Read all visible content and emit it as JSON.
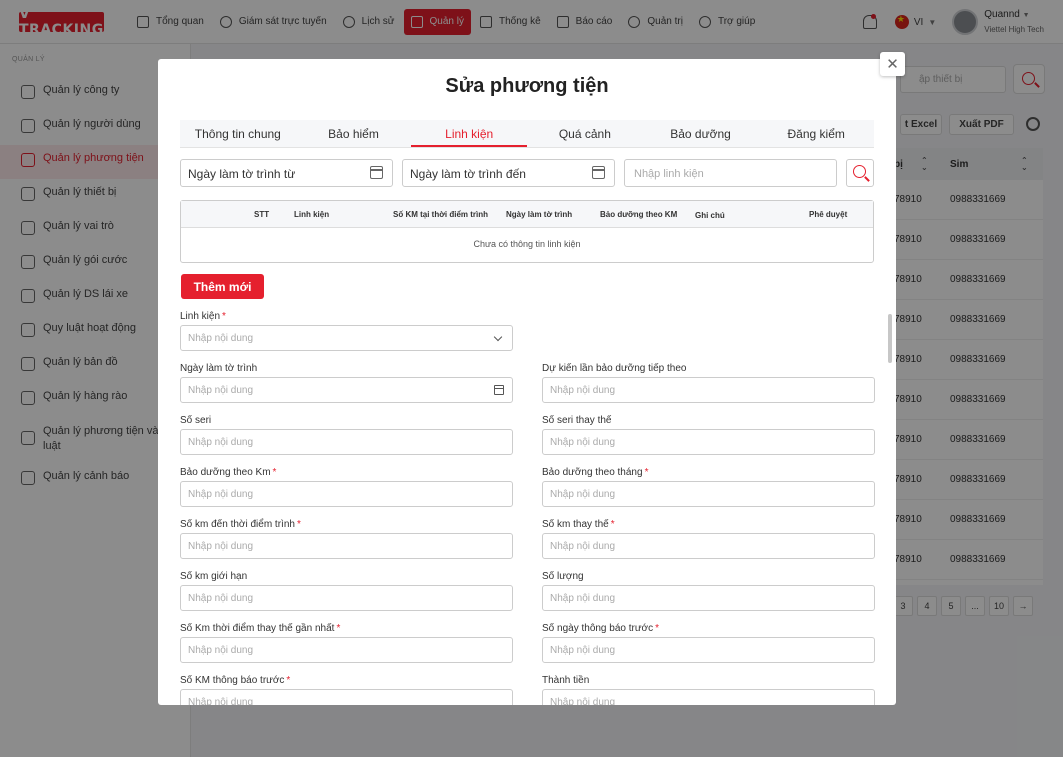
{
  "header": {
    "logo": "V TRACKING",
    "nav": [
      {
        "label": "Tổng quan",
        "icon": "dashboard-icon"
      },
      {
        "label": "Giám sát trực tuyến",
        "icon": "target-icon"
      },
      {
        "label": "Lịch sử",
        "icon": "history-icon"
      },
      {
        "label": "Quản lý",
        "icon": "grid-icon"
      },
      {
        "label": "Thống kê",
        "icon": "document-icon"
      },
      {
        "label": "Báo cáo",
        "icon": "clipboard-icon"
      },
      {
        "label": "Quản trị",
        "icon": "gear-icon"
      },
      {
        "label": "Trợ giúp",
        "icon": "help-icon"
      }
    ],
    "active_nav": "Quản lý",
    "language": "VI",
    "user_name": "Quannd",
    "user_org": "Viettel High Tech"
  },
  "sidebar": {
    "title": "QUẢN LÝ",
    "items": [
      {
        "label": "Quản lý công ty"
      },
      {
        "label": "Quản lý người dùng"
      },
      {
        "label": "Quản lý phương tiện"
      },
      {
        "label": "Quản lý thiết bị"
      },
      {
        "label": "Quản lý vai trò"
      },
      {
        "label": "Quản lý gói cước"
      },
      {
        "label": "Quản lý DS lái xe"
      },
      {
        "label": "Quy luật hoạt động"
      },
      {
        "label": "Quản lý bản đồ"
      },
      {
        "label": "Quản lý hàng rào"
      },
      {
        "label": "Quản lý phương tiện và quy luật"
      },
      {
        "label": "Quản lý cảnh báo"
      }
    ],
    "active_item": "Quản lý phương tiện"
  },
  "background": {
    "search_placeholder": "ập thiết bị",
    "export_excel": "t Excel",
    "export_pdf": "Xuất PDF",
    "col_device": "bị",
    "col_sim": "Sim",
    "rows": [
      {
        "device": "78910",
        "sim": "0988331669"
      },
      {
        "device": "78910",
        "sim": "0988331669"
      },
      {
        "device": "78910",
        "sim": "0988331669"
      },
      {
        "device": "78910",
        "sim": "0988331669"
      },
      {
        "device": "78910",
        "sim": "0988331669"
      },
      {
        "device": "78910",
        "sim": "0988331669"
      },
      {
        "device": "78910",
        "sim": "0988331669"
      },
      {
        "device": "78910",
        "sim": "0988331669"
      },
      {
        "device": "78910",
        "sim": "0988331669"
      },
      {
        "device": "78910",
        "sim": "0988331669"
      }
    ],
    "pages": [
      "3",
      "4",
      "5",
      "...",
      "10",
      "→"
    ]
  },
  "modal": {
    "title": "Sửa phương tiện",
    "close": "✕",
    "tabs": [
      "Thông tin chung",
      "Bảo hiểm",
      "Linh kiện",
      "Quá cảnh",
      "Bảo dưỡng",
      "Đăng kiểm"
    ],
    "active_tab": "Linh kiện",
    "filter": {
      "date_from": "Ngày làm tờ trình từ",
      "date_to": "Ngày làm tờ trình đến",
      "part_placeholder": "Nhập linh kiện"
    },
    "table": {
      "columns": [
        "STT",
        "Linh kiện",
        "Số KM tại thời điểm trình",
        "Ngày làm tờ trình",
        "Bảo dưỡng theo KM",
        "Ghi chú",
        "Phê duyệt"
      ],
      "empty": "Chưa có thông tin linh kiện"
    },
    "add_button": "Thêm mới",
    "form": {
      "placeholder": "Nhập nội dung",
      "fields": [
        {
          "label": "Linh kiện",
          "required": true
        },
        {
          "label": "Ngày làm tờ trình",
          "required": false
        },
        {
          "label": "Dự kiến lần bảo dưỡng tiếp theo",
          "required": false
        },
        {
          "label": "Số seri",
          "required": false
        },
        {
          "label": "Số seri thay thế",
          "required": false
        },
        {
          "label": "Bảo dưỡng theo Km",
          "required": true
        },
        {
          "label": "Bảo dưỡng theo tháng",
          "required": true
        },
        {
          "label": "Số km đến thời điểm trình",
          "required": true
        },
        {
          "label": "Số km thay thế",
          "required": true
        },
        {
          "label": "Số km giới hạn",
          "required": false
        },
        {
          "label": "Số lượng",
          "required": false
        },
        {
          "label": "Số Km thời điểm thay thế gần nhất",
          "required": true
        },
        {
          "label": "Số ngày thông báo trước",
          "required": true
        },
        {
          "label": "Số KM thông báo trước",
          "required": true
        },
        {
          "label": "Thành tiền",
          "required": false
        }
      ]
    }
  },
  "colors": {
    "accent": "#e5202e",
    "active_bg": "#fdeaec"
  }
}
